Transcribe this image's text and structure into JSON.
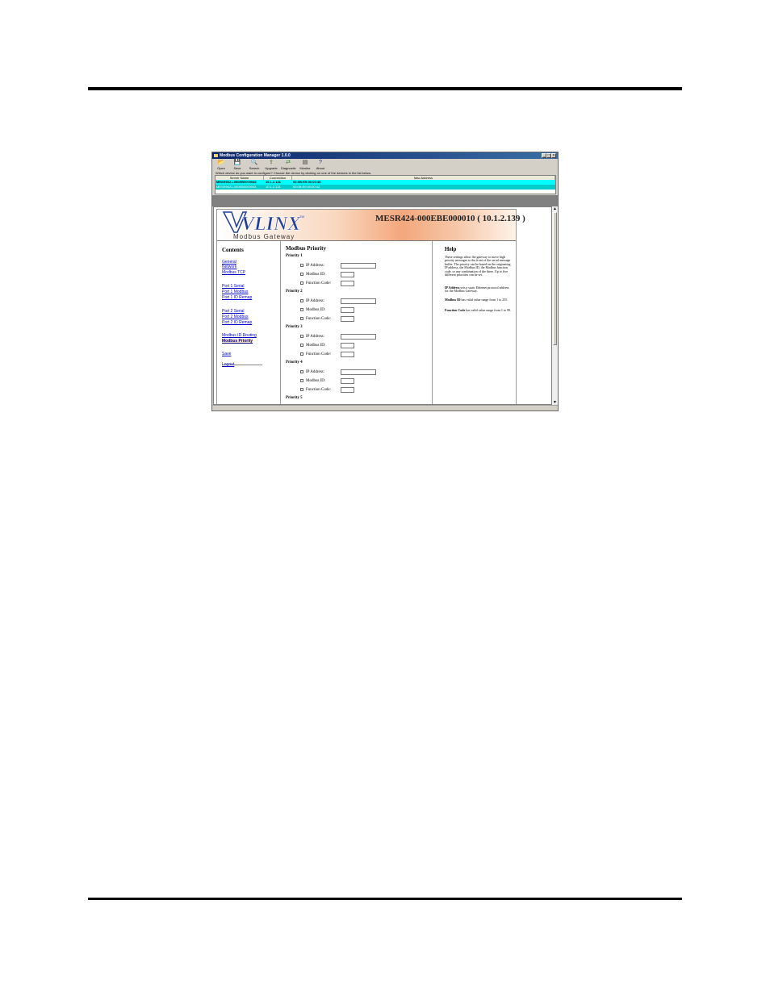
{
  "window": {
    "title": "Modbus Configuration Manager 1.0.0",
    "controls": [
      "_",
      "□",
      "×"
    ]
  },
  "toolbar": [
    {
      "label": "Open",
      "icon": "open-folder-icon",
      "glyph": "📂"
    },
    {
      "label": "Save",
      "icon": "save-disk-icon",
      "glyph": "💾"
    },
    {
      "label": "Search",
      "icon": "search-icon",
      "glyph": "🔍"
    },
    {
      "label": "Upgrade",
      "icon": "upgrade-icon",
      "glyph": "⇪"
    },
    {
      "label": "Diagnostic",
      "icon": "diagnostic-icon",
      "glyph": "⇄"
    },
    {
      "label": "Monitor",
      "icon": "monitor-icon",
      "glyph": "▤"
    },
    {
      "label": "About",
      "icon": "help-question-icon",
      "glyph": "?"
    }
  ],
  "prompt": "Which device do you want to configure? Choose the device by clicking on one of the devices in the list below.",
  "device_table": {
    "columns": [
      "Server Name",
      "Connection",
      "Mac Address"
    ],
    "rows": [
      [
        "MESR9021-000EB0000040",
        "10.1.2.121",
        "00:0B:E9:00:00:40"
      ],
      [
        "MESR9021-000EB0000043",
        "10.1.2.121",
        "00:0B:E9:00:00:43"
      ]
    ]
  },
  "page": {
    "logo_text": "VLINX",
    "logo_tm": "TM",
    "tagline": "Modbus Gateway",
    "device_title": "MESR424-000EBE000010 ( 10.1.2.139 )",
    "contents_heading": "Contents",
    "nav": {
      "general": "General",
      "network": "Network",
      "modbus_tcp": "Modbus TCP",
      "port1_serial": "Port 1 Serial",
      "port1_modbus": "Port 1 Modbus",
      "port1_id_remap": "Port 1 ID Remap",
      "port2_serial": "Port 2 Serial",
      "port2_modbus": "Port 2 Modbus",
      "port2_id_remap": "Port 2 ID Remap",
      "modbus_id_routing": "Modbus ID Routing",
      "modbus_priority": "Modbus Priority",
      "save": "Save",
      "logout": "Logout"
    },
    "section_heading": "Modbus Priority",
    "priorities": [
      "Priority 1",
      "Priority 2",
      "Priority 3",
      "Priority 4",
      "Priority 5"
    ],
    "field_labels": {
      "ip": "IP Address:",
      "modbus_id": "Modbus ID:",
      "function_code": "Function Code:"
    },
    "help": {
      "heading": "Help",
      "intro": "These settings allow the gateway to move high priority messages to the front of the serial message buffer. The priority can be based on the originating IP address, the Modbus ID, the Modbus function code, or any combination of the three. Up to five different priorities can be set.",
      "ip_term": "IP Address",
      "ip_text": " sets a static Ethernet protocol address for the Modbus Gateway.",
      "id_term": "Modbus ID",
      "id_text": " has valid value range from 1 to 255.",
      "fc_term": "Function Code",
      "fc_text": " has valid value range from 1 to 99."
    }
  },
  "colors": {
    "titlebar": "#0a246a",
    "selected_row": "#00ffff",
    "second_row": "#00cccc",
    "link": "#0000cc",
    "banner_accent": "#f3a77c",
    "logo_blue": "#1f3f9a"
  }
}
